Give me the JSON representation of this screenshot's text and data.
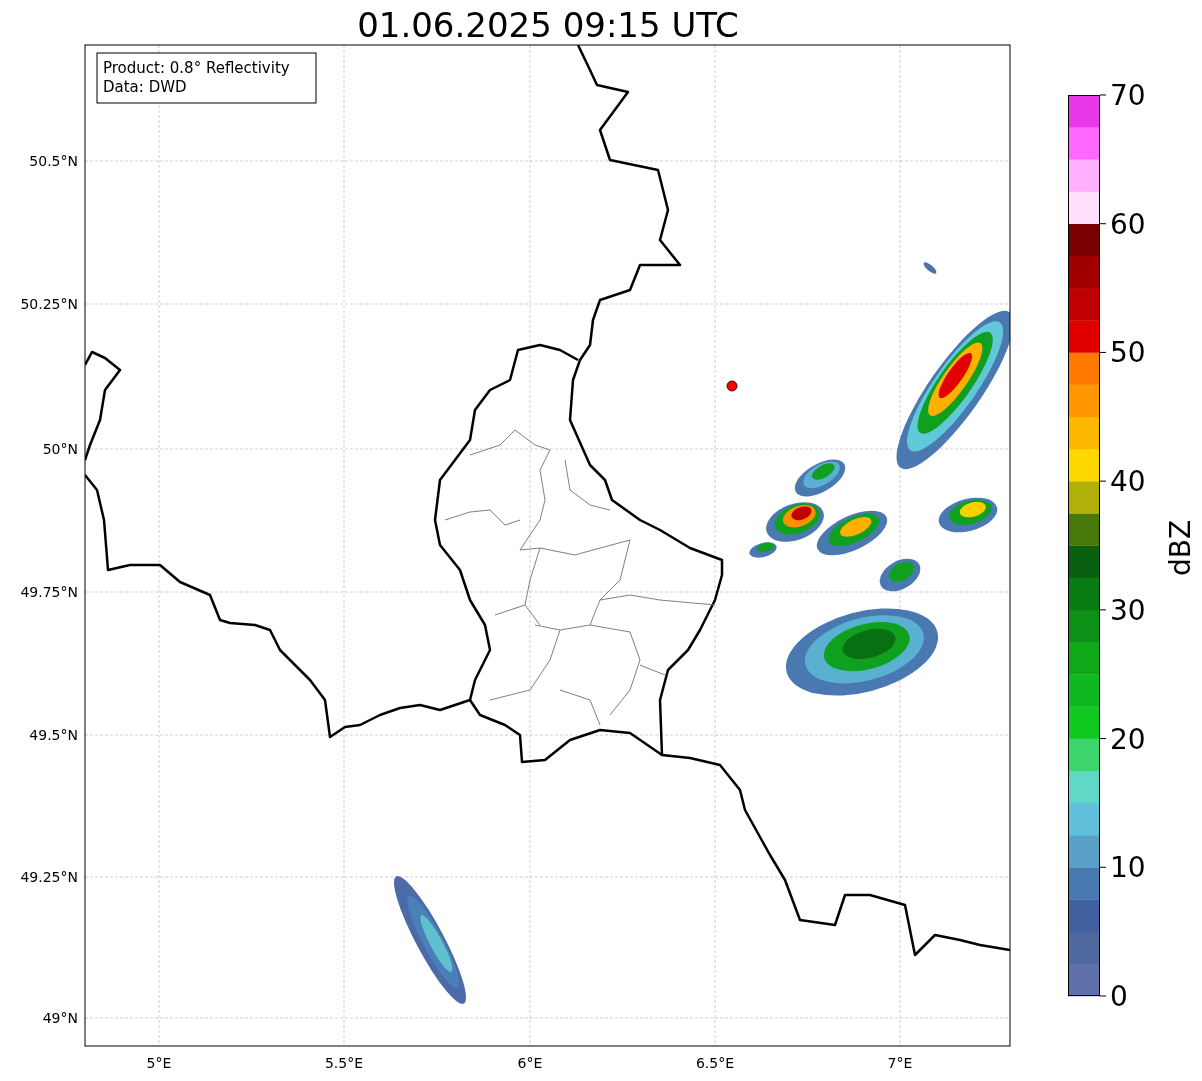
{
  "title": "01.06.2025 09:15 UTC",
  "info_box": [
    "Product: 0.8° Reflectivity",
    "Data: DWD"
  ],
  "map": {
    "x_ticks": [
      "5°E",
      "5.5°E",
      "6°E",
      "6.5°E",
      "7°E"
    ],
    "y_ticks": [
      "50.5°N",
      "50.25°N",
      "50°N",
      "49.75°N",
      "49.5°N",
      "49.25°N",
      "49°N"
    ]
  },
  "colorbar": {
    "label": "dBZ",
    "ticks": [
      "70",
      "60",
      "50",
      "40",
      "30",
      "20",
      "10",
      "0"
    ]
  }
}
